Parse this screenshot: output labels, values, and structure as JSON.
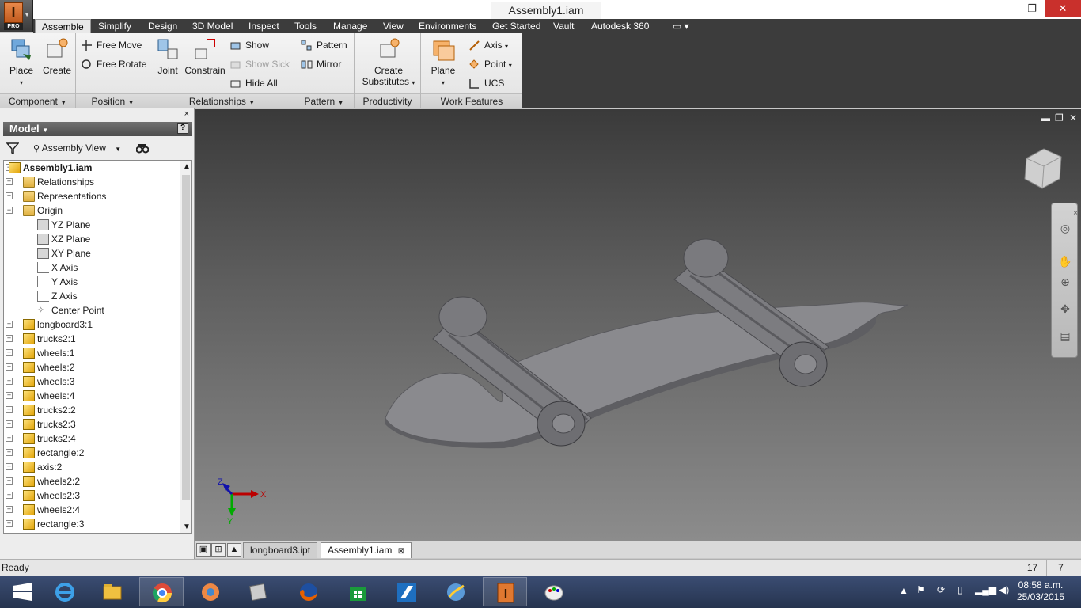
{
  "window": {
    "title": "Assembly1.iam",
    "app_badge": "PRO",
    "minimize": "–",
    "restore": "❐",
    "close": "✕"
  },
  "ribbon_tabs": [
    "Assemble",
    "Simplify",
    "Design",
    "3D Model",
    "Inspect",
    "Tools",
    "Manage",
    "View",
    "Environments",
    "Get Started",
    "Vault",
    "Autodesk 360"
  ],
  "ribbon": {
    "component": {
      "label": "Component",
      "place": "Place",
      "create": "Create"
    },
    "position": {
      "label": "Position",
      "free_move": "Free Move",
      "free_rotate": "Free Rotate"
    },
    "relationships": {
      "label": "Relationships",
      "joint": "Joint",
      "constrain": "Constrain",
      "show": "Show",
      "show_sick": "Show Sick",
      "hide_all": "Hide All"
    },
    "pattern": {
      "label": "Pattern",
      "pattern": "Pattern",
      "mirror": "Mirror"
    },
    "productivity": {
      "label": "Productivity",
      "create_substitutes_1": "Create",
      "create_substitutes_2": "Substitutes"
    },
    "work_features": {
      "label": "Work Features",
      "plane": "Plane",
      "axis": "Axis",
      "point": "Point",
      "ucs": "UCS"
    }
  },
  "browser": {
    "close": "×",
    "header": "Model",
    "help": "?",
    "view_selector": "Assembly View",
    "tree": [
      {
        "label": "Assembly1.iam",
        "icon": "assembly-icon",
        "level": 0,
        "expander": "−",
        "bold": true
      },
      {
        "label": "Relationships",
        "icon": "folder-icon",
        "level": 1,
        "expander": "+"
      },
      {
        "label": "Representations",
        "icon": "representations-icon",
        "level": 1,
        "expander": "+"
      },
      {
        "label": "Origin",
        "icon": "open-folder-icon",
        "level": 1,
        "expander": "−"
      },
      {
        "label": "YZ Plane",
        "icon": "plane-icon",
        "level": 2,
        "expander": ""
      },
      {
        "label": "XZ Plane",
        "icon": "plane-icon",
        "level": 2,
        "expander": ""
      },
      {
        "label": "XY Plane",
        "icon": "plane-icon",
        "level": 2,
        "expander": ""
      },
      {
        "label": "X Axis",
        "icon": "axis-icon",
        "level": 2,
        "expander": ""
      },
      {
        "label": "Y Axis",
        "icon": "axis-icon",
        "level": 2,
        "expander": ""
      },
      {
        "label": "Z Axis",
        "icon": "axis-icon",
        "level": 2,
        "expander": ""
      },
      {
        "label": "Center Point",
        "icon": "point-icon",
        "level": 2,
        "expander": ""
      },
      {
        "label": "longboard3:1",
        "icon": "part-icon",
        "level": 1,
        "expander": "+"
      },
      {
        "label": "trucks2:1",
        "icon": "part-icon",
        "level": 1,
        "expander": "+"
      },
      {
        "label": "wheels:1",
        "icon": "part-icon",
        "level": 1,
        "expander": "+"
      },
      {
        "label": "wheels:2",
        "icon": "part-icon",
        "level": 1,
        "expander": "+"
      },
      {
        "label": "wheels:3",
        "icon": "part-icon",
        "level": 1,
        "expander": "+"
      },
      {
        "label": "wheels:4",
        "icon": "part-icon",
        "level": 1,
        "expander": "+"
      },
      {
        "label": "trucks2:2",
        "icon": "part-icon",
        "level": 1,
        "expander": "+"
      },
      {
        "label": "trucks2:3",
        "icon": "part-icon",
        "level": 1,
        "expander": "+"
      },
      {
        "label": "trucks2:4",
        "icon": "part-icon",
        "level": 1,
        "expander": "+"
      },
      {
        "label": "rectangle:2",
        "icon": "part-icon",
        "level": 1,
        "expander": "+"
      },
      {
        "label": "axis:2",
        "icon": "part-icon",
        "level": 1,
        "expander": "+"
      },
      {
        "label": "wheels2:2",
        "icon": "part-icon",
        "level": 1,
        "expander": "+"
      },
      {
        "label": "wheels2:3",
        "icon": "part-icon",
        "level": 1,
        "expander": "+"
      },
      {
        "label": "wheels2:4",
        "icon": "part-icon",
        "level": 1,
        "expander": "+"
      },
      {
        "label": "rectangle:3",
        "icon": "part-icon",
        "level": 1,
        "expander": "+"
      }
    ]
  },
  "viewport": {
    "triad": {
      "x": "X",
      "y": "Y",
      "z": "Z"
    },
    "colors": {
      "background_top": "#3a3a3a",
      "background_bottom": "#8c8c8c",
      "model": "#8a8a8e"
    }
  },
  "document_tabs": [
    "longboard3.ipt",
    "Assembly1.iam"
  ],
  "document_tab_close": "⊠",
  "status": {
    "text": "Ready",
    "num1": "17",
    "num2": "7"
  },
  "taskbar": {
    "apps": [
      "start-icon",
      "internet-explorer-icon",
      "file-explorer-icon",
      "chrome-icon",
      "picasa-icon",
      "scanner-icon",
      "firefox-icon",
      "windows-store-icon",
      "autodesk-icon",
      "browser-globe-icon",
      "inventor-icon",
      "paint-icon"
    ],
    "time": "08:58 a.m.",
    "date": "25/03/2015"
  }
}
